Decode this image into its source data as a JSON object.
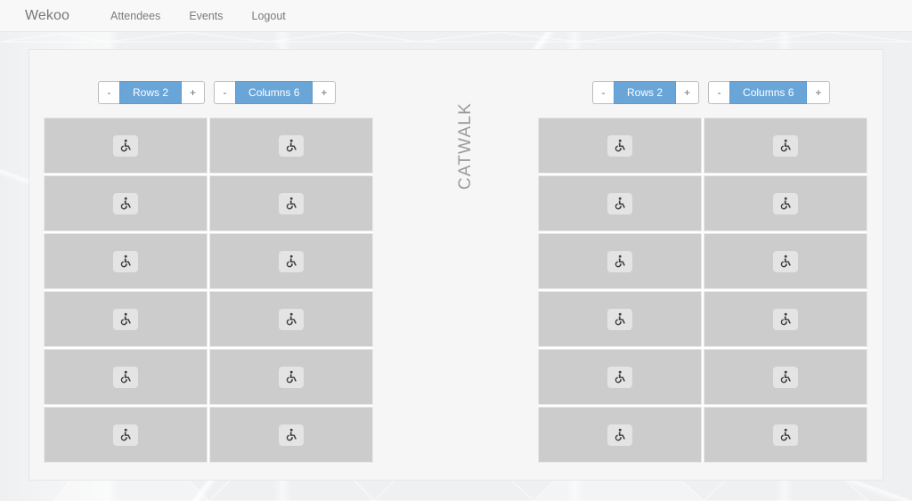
{
  "navbar": {
    "brand": "Wekoo",
    "links": [
      {
        "label": "Attendees",
        "name": "nav-link-attendees"
      },
      {
        "label": "Events",
        "name": "nav-link-events"
      },
      {
        "label": "Logout",
        "name": "nav-link-logout"
      }
    ]
  },
  "stage": {
    "catwalk_label": "CATWALK"
  },
  "colors": {
    "accent_blue": "#6aa5d8",
    "accent_blue_border": "#5f9bd0",
    "seat_fill": "#cccccc",
    "seat_border": "#e9e9e9",
    "seat_badge": "#e4e4e4",
    "panel_bg": "#f6f6f6",
    "page_bg": "#eef0f1",
    "navbar_bg": "#f8f8f8",
    "text_muted": "#7b7b7b",
    "catwalk_text": "#9a9a9a"
  },
  "sections": [
    {
      "id": "left",
      "name": "seating-section-left",
      "controls": {
        "rows": {
          "decrement_label": "-",
          "value_label": "Rows 2",
          "increment_label": "+",
          "value": 2
        },
        "columns": {
          "decrement_label": "-",
          "value_label": "Columns 6",
          "increment_label": "+",
          "value": 6
        }
      },
      "grid": {
        "columns": 2,
        "rows": 6,
        "seat_icon": "wheelchair-accessible-icon",
        "seat_count": 12
      }
    },
    {
      "id": "right",
      "name": "seating-section-right",
      "controls": {
        "rows": {
          "decrement_label": "-",
          "value_label": "Rows 2",
          "increment_label": "+",
          "value": 2
        },
        "columns": {
          "decrement_label": "-",
          "value_label": "Columns 6",
          "increment_label": "+",
          "value": 6
        }
      },
      "grid": {
        "columns": 2,
        "rows": 6,
        "seat_icon": "wheelchair-accessible-icon",
        "seat_count": 12
      }
    }
  ]
}
